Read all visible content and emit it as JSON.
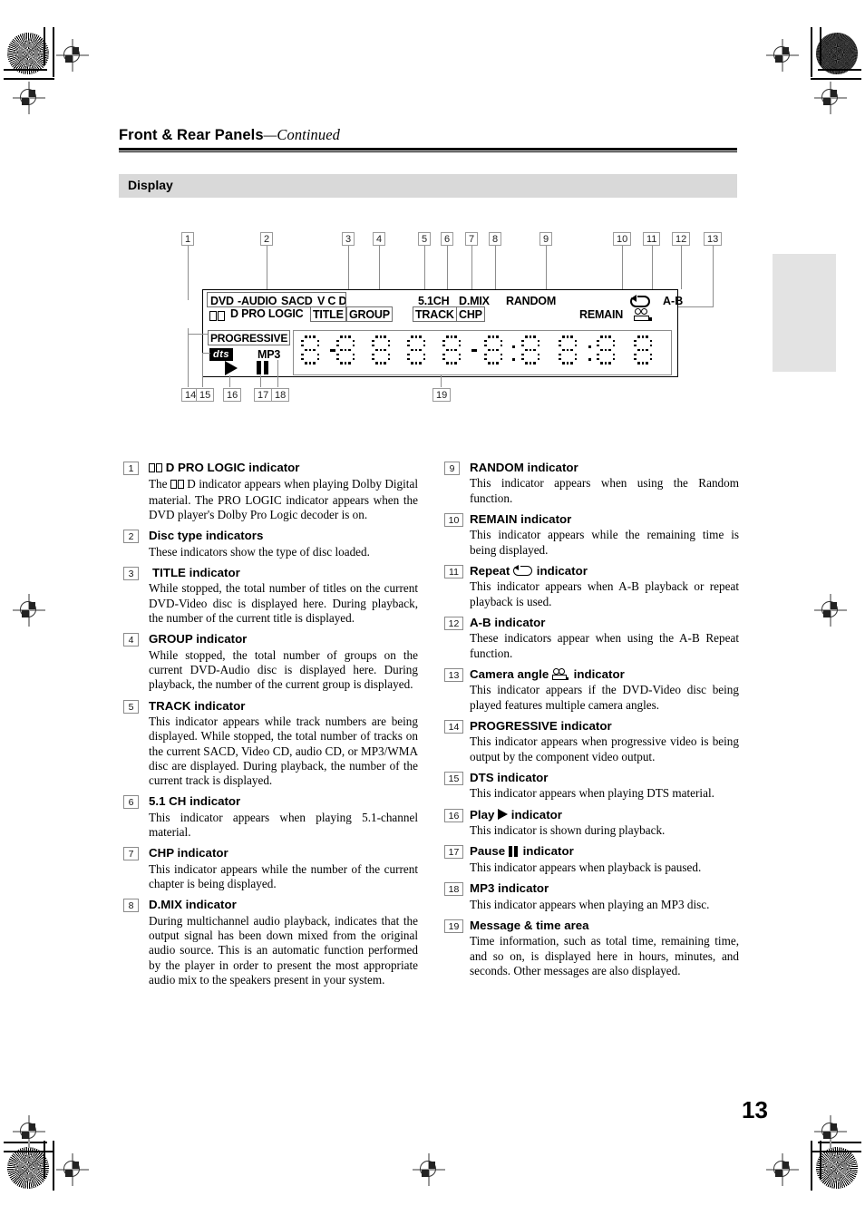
{
  "header": {
    "title_bold": "Front & Rear Panels",
    "title_italic": "—Continued",
    "section": "Display",
    "page_number": "13"
  },
  "display_panel": {
    "row1_labels": [
      "DVD",
      "-AUDIO",
      "SACD",
      "V C D"
    ],
    "row2_labels": [
      "D PRO LOGIC",
      "TITLE",
      "GROUP"
    ],
    "right_row1": [
      "5.1CH",
      "D.MIX",
      "RANDOM"
    ],
    "right_row2": [
      "TRACK",
      "CHP",
      "REMAIN"
    ],
    "ab_label": "A-B",
    "progressive": "PROGRESSIVE",
    "dts": "dts",
    "mp3": "MP3",
    "icons": {
      "dolby": "dolby-double-d-icon",
      "repeat_loop": "repeat-loop-icon",
      "camera_angle": "camera-angle-icon",
      "play": "play-triangle-icon",
      "pause": "pause-bars-icon"
    },
    "callouts_top": [
      "1",
      "2",
      "3",
      "4",
      "5",
      "6",
      "7",
      "8",
      "9",
      "10",
      "11",
      "12",
      "13"
    ],
    "callouts_bottom": [
      "14",
      "15",
      "16",
      "17",
      "18",
      "19"
    ]
  },
  "left_column": [
    {
      "num": "1",
      "title_pre": "",
      "title": "D PRO LOGIC indicator",
      "has_dolby_in_title": true,
      "body_pre": "The ",
      "body": " D indicator appears when playing Dolby Digital material. The PRO LOGIC indicator appears when the DVD player's Dolby Pro Logic decoder is on.",
      "has_dolby_in_body": true
    },
    {
      "num": "2",
      "title": "Disc type indicators",
      "body": "These indicators show the type of disc loaded."
    },
    {
      "num": "3",
      "title": "TITLE indicator",
      "body": "While stopped, the total number of titles on the current DVD-Video disc is displayed here. During playback, the number of the current title is displayed."
    },
    {
      "num": "4",
      "title": "GROUP indicator",
      "body": "While stopped, the total number of groups on the current DVD-Audio disc is displayed here. During playback, the number of the current group is displayed."
    },
    {
      "num": "5",
      "title": "TRACK indicator",
      "body": "This indicator appears while track numbers are being displayed. While stopped, the total number of tracks on the current SACD, Video CD, audio CD, or MP3/WMA disc are displayed. During playback, the number of the current track is displayed."
    },
    {
      "num": "6",
      "title": "5.1 CH indicator",
      "body": "This indicator appears when playing 5.1-channel material."
    },
    {
      "num": "7",
      "title": "CHP indicator",
      "body": "This indicator appears while the number of the current chapter is being displayed."
    },
    {
      "num": "8",
      "title": "D.MIX indicator",
      "body": "During multichannel audio playback, indicates that the output signal has been down mixed from the original audio source. This is an automatic function performed by the player in order to present the most appropriate audio mix to the speakers present in your system."
    }
  ],
  "right_column": [
    {
      "num": "9",
      "title": "RANDOM indicator",
      "body": "This indicator appears when using the Random function."
    },
    {
      "num": "10",
      "title": "REMAIN indicator",
      "body": "This indicator appears while the remaining time is being displayed."
    },
    {
      "num": "11",
      "title_pre": "Repeat",
      "title_post": "indicator",
      "icon": "repeat-loop-icon",
      "body": "This indicator appears when A-B playback or repeat playback is used."
    },
    {
      "num": "12",
      "title": "A-B indicator",
      "body": "These indicators appear when using the A-B Repeat function."
    },
    {
      "num": "13",
      "title_pre": "Camera angle",
      "title_post": "indicator",
      "icon": "camera-angle-icon",
      "body": "This indicator appears if the DVD-Video disc being played features multiple camera angles."
    },
    {
      "num": "14",
      "title": "PROGRESSIVE indicator",
      "body": "This indicator appears when progressive video is being output by the component video output."
    },
    {
      "num": "15",
      "title": "DTS indicator",
      "body": "This indicator appears when playing DTS material."
    },
    {
      "num": "16",
      "title_pre": "Play",
      "title_post": "indicator",
      "icon": "play-triangle-icon",
      "body": "This indicator is shown during playback."
    },
    {
      "num": "17",
      "title_pre": "Pause",
      "title_post": "indicator",
      "icon": "pause-bars-icon",
      "body": "This indicator appears when playback is paused."
    },
    {
      "num": "18",
      "title": "MP3 indicator",
      "body": "This indicator appears when playing an MP3 disc."
    },
    {
      "num": "19",
      "title": "Message & time area",
      "body": "Time information, such as total time, remaining time, and so on, is displayed here in hours, minutes, and seconds. Other messages are also displayed."
    }
  ],
  "colors": {
    "section_bar": "#d9d9d9",
    "tab_mark": "#e3e3e3",
    "callout_border": "#8a8a8a",
    "leader": "#8d8d8d"
  }
}
